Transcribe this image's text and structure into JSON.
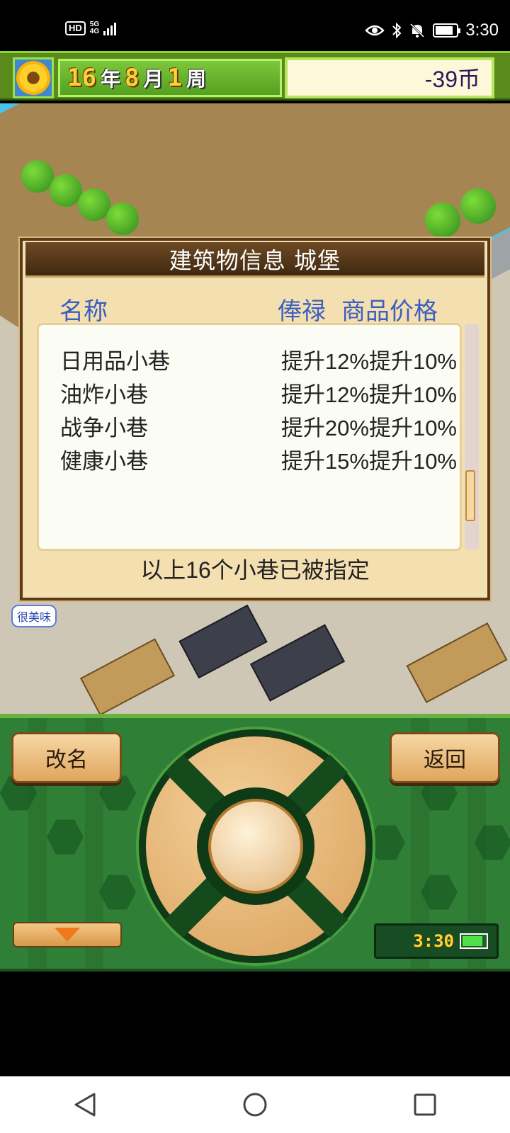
{
  "status_bar": {
    "hd": "HD",
    "network": "5G",
    "network_sub": "4G",
    "time": "3:30"
  },
  "top_bar": {
    "year": "16",
    "year_unit": "年",
    "month": "8",
    "month_unit": "月",
    "week": "1",
    "week_unit": "周",
    "money": "-39币"
  },
  "world": {
    "bubble": "很美味"
  },
  "dialog": {
    "title": "建筑物信息 城堡",
    "col_name": "名称",
    "col_salary": "俸禄",
    "col_price": "商品价格",
    "rows": [
      {
        "name": "日用品小巷",
        "value": "提升12%提升10%"
      },
      {
        "name": "油炸小巷",
        "value": "提升12%提升10%"
      },
      {
        "name": "战争小巷",
        "value": "提升20%提升10%"
      },
      {
        "name": "健康小巷",
        "value": "提升15%提升10%"
      }
    ],
    "footer": "以上16个小巷已被指定",
    "scroll_position": 0.85
  },
  "panel": {
    "rename_label": "改名",
    "back_label": "返回",
    "clock": "3:30"
  },
  "colors": {
    "header_blue": "#3a5fc0",
    "panel_green": "#2f7f36",
    "money_text": "#2a1a60"
  },
  "icons": {
    "dialog_back": "triangle-back-icon",
    "home": "circle-home-icon",
    "recents": "square-recents-icon",
    "eye": "eye-icon",
    "bluetooth": "bluetooth-icon",
    "mute": "bell-mute-icon",
    "battery": "battery-icon",
    "sunflower": "sunflower-icon",
    "down": "down-arrow-icon"
  }
}
